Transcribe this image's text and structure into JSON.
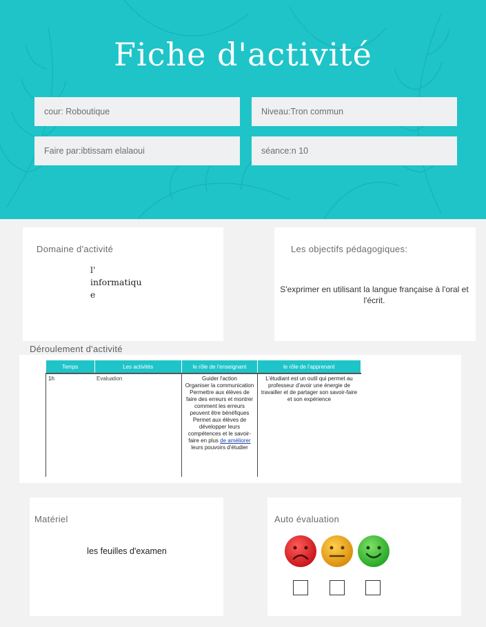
{
  "header": {
    "title": "Fiche d'activité",
    "fields": {
      "cours": "cour: Roboutique",
      "niveau": "Niveau:Tron commun",
      "auteur": "Faire par:ibtissam elalaoui",
      "seance": "séance:n 10"
    }
  },
  "domaine": {
    "title": "Domaine d'activité",
    "line1": "l'",
    "line2": "informatiqu",
    "line3": "e"
  },
  "objectifs": {
    "title": "Les objectifs pédagogiques:",
    "text": "S'exprimer en utilisant la langue française à l'oral et l'écrit."
  },
  "deroulement": {
    "title": "Déroulement d'activité",
    "headers": [
      "Temps",
      "Les activités",
      "le rôle de l'enseignant",
      "le rôle de l'apprenant"
    ],
    "row": {
      "temps": "1h",
      "activite": "Evaluation",
      "enseignant_1": "Guider l'action",
      "enseignant_2": "Organiser la communication",
      "enseignant_3": "Permettre aux élèves de faire des erreurs et montrer comment les erreurs peuvent être bénéfiques",
      "enseignant_4": "Permet aux élèves de développer leurs compétences et le savoir-faire en plus",
      "enseignant_link": "de améliorer",
      "enseignant_5": "leurs pouvoirs d'étudier",
      "apprenant": "L'étudiant est un outil qui permet au professeur d'avoir une énergie de travailler et de partager son savoir-faire et son expérience"
    }
  },
  "materiel": {
    "title": "Matériel",
    "text": "les feuilles d'examen"
  },
  "auto_evaluation": {
    "title": "Auto évaluation",
    "faces": [
      {
        "icon": "sad-face-icon",
        "color": "#e8262a"
      },
      {
        "icon": "neutral-face-icon",
        "color": "#f0a91c"
      },
      {
        "icon": "happy-face-icon",
        "color": "#3fc63a"
      }
    ]
  },
  "colors": {
    "accent": "#1ec4c8",
    "field_bg": "#eff0f2"
  }
}
